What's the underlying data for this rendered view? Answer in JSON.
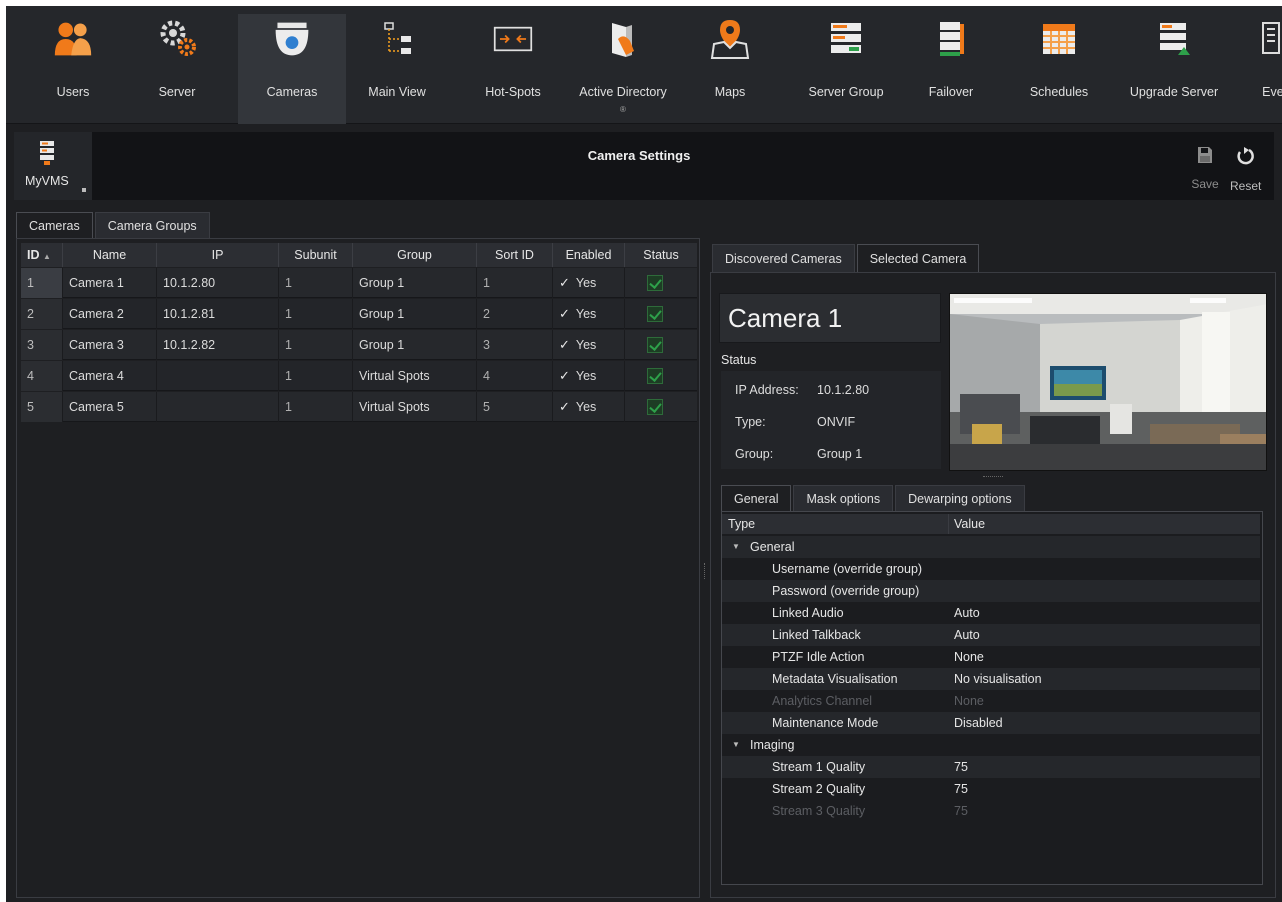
{
  "toolbar": {
    "items": [
      {
        "label": "Users",
        "icon": "users-icon"
      },
      {
        "label": "Server",
        "icon": "server-gears-icon"
      },
      {
        "label": "Cameras",
        "icon": "camera-icon"
      },
      {
        "label": "Main View",
        "icon": "main-view-icon"
      },
      {
        "label": "Hot-Spots",
        "icon": "hot-spots-icon"
      },
      {
        "label": "Active Directory",
        "sub": "®",
        "icon": "active-directory-icon"
      },
      {
        "label": "Maps",
        "icon": "maps-icon"
      },
      {
        "label": "Server Group",
        "icon": "server-group-icon"
      },
      {
        "label": "Failover",
        "icon": "failover-icon"
      },
      {
        "label": "Schedules",
        "icon": "schedules-icon"
      },
      {
        "label": "Upgrade Server",
        "icon": "upgrade-server-icon"
      },
      {
        "label": "Ever",
        "icon": "events-icon"
      }
    ],
    "active": "Cameras"
  },
  "header": {
    "server_label": "MyVMS",
    "title": "Camera Settings",
    "save_label": "Save",
    "reset_label": "Reset"
  },
  "left_tabs": [
    "Cameras",
    "Camera Groups"
  ],
  "camera_table": {
    "columns": [
      "ID",
      "Name",
      "IP",
      "Subunit",
      "Group",
      "Sort ID",
      "Enabled",
      "Status"
    ],
    "sort_indicator": "▲",
    "rows": [
      {
        "id": "1",
        "name": "Camera 1",
        "ip": "10.1.2.80",
        "subunit": "1",
        "group": "Group 1",
        "sort_id": "1",
        "enabled": "Yes"
      },
      {
        "id": "2",
        "name": "Camera 2",
        "ip": "10.1.2.81",
        "subunit": "1",
        "group": "Group 1",
        "sort_id": "2",
        "enabled": "Yes"
      },
      {
        "id": "3",
        "name": "Camera 3",
        "ip": "10.1.2.82",
        "subunit": "1",
        "group": "Group 1",
        "sort_id": "3",
        "enabled": "Yes"
      },
      {
        "id": "4",
        "name": "Camera 4",
        "ip": "",
        "subunit": "1",
        "group": "Virtual Spots",
        "sort_id": "4",
        "enabled": "Yes"
      },
      {
        "id": "5",
        "name": "Camera 5",
        "ip": "",
        "subunit": "1",
        "group": "Virtual Spots",
        "sort_id": "5",
        "enabled": "Yes"
      }
    ],
    "check_glyph": "✓"
  },
  "right_tabs": [
    "Discovered Cameras",
    "Selected Camera"
  ],
  "selected_camera": {
    "name": "Camera 1",
    "status_label": "Status",
    "ip_label": "IP Address:",
    "ip": "10.1.2.80",
    "type_label": "Type:",
    "type": "ONVIF",
    "group_label": "Group:",
    "group": "Group 1"
  },
  "sub_tabs": [
    "General",
    "Mask options",
    "Dewarping options"
  ],
  "properties": {
    "col_type": "Type",
    "col_value": "Value",
    "groups": [
      {
        "name": "General",
        "rows": [
          {
            "type": "Username (override group)",
            "value": ""
          },
          {
            "type": "Password (override group)",
            "value": ""
          },
          {
            "type": "Linked Audio",
            "value": "Auto"
          },
          {
            "type": "Linked Talkback",
            "value": "Auto"
          },
          {
            "type": "PTZF Idle Action",
            "value": "None"
          },
          {
            "type": "Metadata Visualisation",
            "value": "No visualisation"
          },
          {
            "type": "Analytics Channel",
            "value": "None"
          },
          {
            "type": "Maintenance Mode",
            "value": "Disabled"
          }
        ]
      },
      {
        "name": "Imaging",
        "rows": [
          {
            "type": "Stream 1 Quality",
            "value": "75"
          },
          {
            "type": "Stream 2 Quality",
            "value": "75"
          },
          {
            "type": "Stream 3 Quality",
            "value": "75"
          }
        ]
      }
    ]
  },
  "colors": {
    "accent": "#e8731c",
    "status_green": "#2ea04a"
  }
}
